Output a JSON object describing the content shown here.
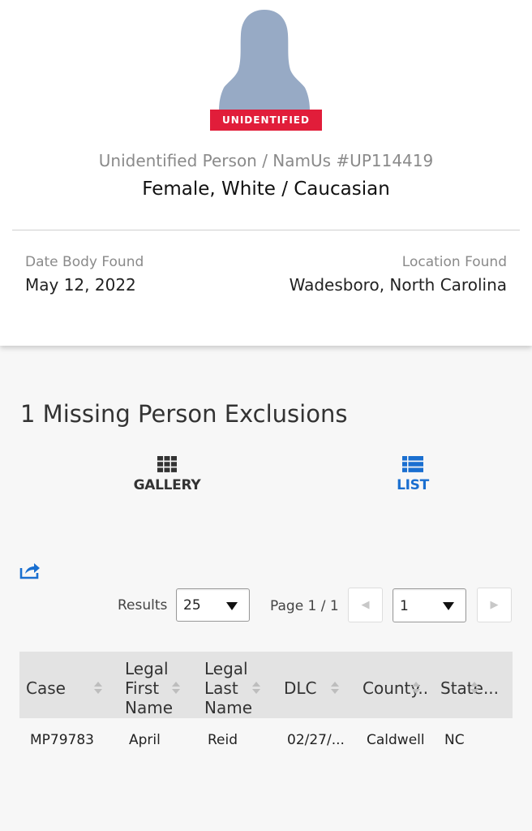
{
  "profile": {
    "badge": "UNIDENTIFIED",
    "case_title": "Unidentified Person / NamUs #UP114419",
    "case_subtitle": "Female, White / Caucasian",
    "date_label": "Date Body Found",
    "date_value": "May 12, 2022",
    "location_label": "Location Found",
    "location_value": "Wadesboro, North Carolina"
  },
  "exclusions": {
    "title": "1 Missing Person Exclusions",
    "tabs": [
      {
        "label": "GALLERY",
        "icon": "grid-icon"
      },
      {
        "label": "LIST",
        "icon": "list-icon"
      }
    ],
    "results_label": "Results",
    "results_value": "25",
    "page_info": "Page 1 / 1",
    "page_value": "1",
    "prev_glyph": "◀",
    "next_glyph": "▶",
    "columns": {
      "case": "Case",
      "first_name_1": "Legal",
      "first_name_2": "First",
      "first_name_3": "Name",
      "last_name_1": "Legal",
      "last_name_2": "Last",
      "last_name_3": "Name",
      "dlc": "DLC",
      "county": "County...",
      "state": "State..."
    },
    "rows": [
      {
        "case": "MP79783",
        "first": "April",
        "last": "Reid",
        "dlc": "02/27/...",
        "county": "Caldwell",
        "state": "NC"
      }
    ]
  },
  "colors": {
    "badge": "#e11d3a",
    "accent": "#1a6fd0",
    "silhouette": "#97aac5"
  }
}
